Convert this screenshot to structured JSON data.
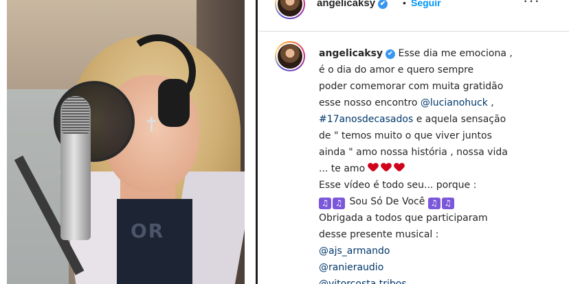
{
  "header": {
    "username": "angelicaksy",
    "verified_mark": "✔",
    "separator": "•",
    "follow_label": "Seguir",
    "more_label": "···"
  },
  "media": {
    "shirt_text": "OR"
  },
  "caption": {
    "username": "angelicaksy",
    "verified_mark": "✔",
    "lines": [
      "Esse dia me emociona ,",
      "é o dia do amor e quero sempre",
      "poder comemorar com muita gratidão",
      "esse nosso encontro",
      "@lucianohuck",
      ",",
      "#17anosdecasados",
      "e aquela sensação",
      "de \" temos muito o que viver juntos",
      "ainda \" amo nossa história , nossa vida",
      "... te amo",
      "Esse vídeo é todo seu... porque :",
      "Sou Só De Você",
      "Obrigada a todos que participaram",
      "desse presente musical :",
      "@ajs_armando",
      "@ranieraudio",
      "@vitorcosta.tribos"
    ],
    "music_note": "♫"
  },
  "colors": {
    "link": "#00376b",
    "follow": "#0095f6",
    "verified": "#3897f0",
    "heart": "#d0021b",
    "note_emoji": "#7b57d9"
  }
}
